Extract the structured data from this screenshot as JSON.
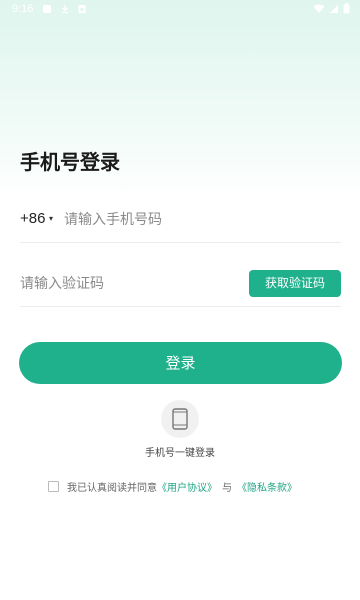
{
  "status_bar": {
    "time": "9:16"
  },
  "page_title": "手机号登录",
  "phone": {
    "country_code": "+86",
    "caret": "▾",
    "placeholder": "请输入手机号码",
    "value": ""
  },
  "code": {
    "placeholder": "请输入验证码",
    "value": "",
    "get_code_label": "获取验证码"
  },
  "login_button": "登录",
  "one_key_login": {
    "icon": "phone-icon",
    "label": "手机号一键登录"
  },
  "agreement": {
    "prefix": "我已认真阅读并同意",
    "user_agreement": "《用户协议》",
    "joiner": "与",
    "privacy_policy": "《隐私条款》",
    "checked": false
  },
  "colors": {
    "accent": "#1fb08c",
    "link": "#1fa585",
    "header_gradient_top": "#dff5ee"
  }
}
